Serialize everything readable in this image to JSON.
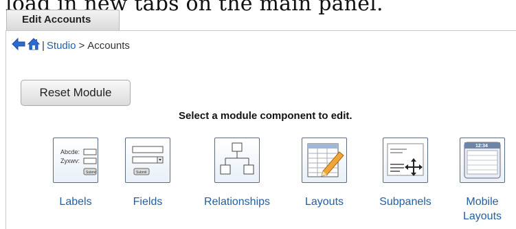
{
  "caption": "load in new tabs on the main panel.",
  "tab": {
    "label": "Edit Accounts"
  },
  "breadcrumb": {
    "separator": "|",
    "studio": "Studio",
    "gt": ">",
    "current": "Accounts"
  },
  "reset_button": "Reset Module",
  "instruction": "Select a module component to edit.",
  "components": [
    {
      "label": "Labels",
      "icon": "labels-icon",
      "icon_text_1": "Abcde:",
      "icon_text_2": "Zyxwv:",
      "icon_button": "Submit"
    },
    {
      "label": "Fields",
      "icon": "fields-icon",
      "icon_button": "Submit"
    },
    {
      "label": "Relationships",
      "icon": "relationships-icon"
    },
    {
      "label": "Layouts",
      "icon": "layouts-icon"
    },
    {
      "label": "Subpanels",
      "icon": "subpanels-icon"
    },
    {
      "label_1": "Mobile",
      "label_2": "Layouts",
      "icon": "mobile-layouts-icon",
      "icon_time": "12:34"
    }
  ],
  "colors": {
    "link": "#1f5fa6",
    "arrow": "#2a6ad1"
  }
}
